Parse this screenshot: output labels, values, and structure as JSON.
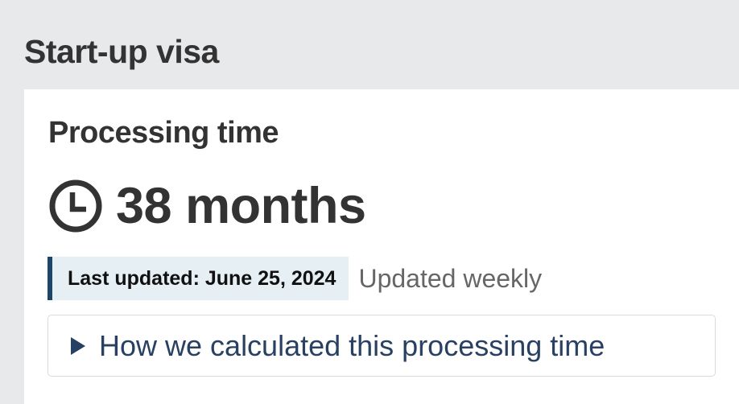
{
  "page": {
    "title": "Start-up visa"
  },
  "processing": {
    "heading": "Processing time",
    "icon": "clock-icon",
    "value": "38 months",
    "last_updated": "Last updated: June 25, 2024",
    "frequency": "Updated weekly",
    "details_label": "How we calculated this processing time",
    "details_icon": "triangle-right-icon"
  },
  "colors": {
    "background": "#e8e9eb",
    "card": "#ffffff",
    "text": "#333333",
    "highlight_bg": "#e6f0f4",
    "highlight_border": "#1c4669",
    "link": "#284162",
    "muted": "#666666"
  }
}
